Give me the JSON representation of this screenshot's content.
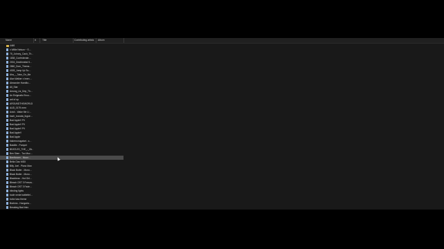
{
  "columns": {
    "name": "Name",
    "number": "#",
    "title": "Title",
    "artists": "Contributing artists",
    "album": "Album"
  },
  "files": [
    {
      "name": "4469",
      "type": "folder"
    },
    {
      "name": "x Willie Nelson ~ S…",
      "type": "file"
    },
    {
      "name": "75_Johnny_Cash_Th…",
      "type": "file"
    },
    {
      "name": "1838_Confederate…",
      "type": "file"
    },
    {
      "name": "2004_Deathmetal K…",
      "type": "file"
    },
    {
      "name": "2860_Dom_Thema…",
      "type": "file"
    },
    {
      "name": "4028_Jump Up Su…",
      "type": "file"
    },
    {
      "name": "Aha_-_Take_On_Me",
      "type": "file"
    },
    {
      "name": "Alan Walker x Imen…",
      "type": "file"
    },
    {
      "name": "Alexander Hamilto…",
      "type": "file"
    },
    {
      "name": "All_Star",
      "type": "file"
    },
    {
      "name": "Among_Us_Drip_Th…",
      "type": "file"
    },
    {
      "name": "An Enigmatic Enco…",
      "type": "file"
    },
    {
      "name": "anf of op",
      "type": "file"
    },
    {
      "name": "AROUNDTHEWORLD",
      "type": "file"
    },
    {
      "name": "AUD_0179.mrrn",
      "type": "file"
    },
    {
      "name": "Avicii - Wake Me U…",
      "type": "file"
    },
    {
      "name": "bach_toccata_fugue…",
      "type": "file"
    },
    {
      "name": "Bad Apple!! PV",
      "type": "file"
    },
    {
      "name": "Bad Apple!! PV",
      "type": "file"
    },
    {
      "name": "Bad Apple!! PV",
      "type": "file"
    },
    {
      "name": "Bad Apple!!",
      "type": "file"
    },
    {
      "name": "Bad Apple",
      "type": "file"
    },
    {
      "name": "bakemonogatari - s…",
      "type": "file"
    },
    {
      "name": "Bastille - Pompeii",
      "type": "file"
    },
    {
      "name": "BEATLES_THE_-_Ob…",
      "type": "file"
    },
    {
      "name": "Ben Siem - Too Muc…",
      "type": "file"
    },
    {
      "name": "Beethoven - Moon…",
      "type": "file",
      "selected": true
    },
    {
      "name": "Bella Ciao MIDI",
      "type": "file"
    },
    {
      "name": "Billy Joel - Piano Man",
      "type": "file"
    },
    {
      "name": "Black Butler - Mono…",
      "type": "file"
    },
    {
      "name": "Black Butler - Mono…",
      "type": "file"
    },
    {
      "name": "Blackbear - Hot Girl…",
      "type": "file"
    },
    {
      "name": "Bleach OST 3 Freeza…",
      "type": "file"
    },
    {
      "name": "Bleach OST 3 Fade…",
      "type": "file"
    },
    {
      "name": "blinding lights",
      "type": "file"
    },
    {
      "name": "bode verde battlefiel…",
      "type": "file"
    },
    {
      "name": "bofor lass theme",
      "type": "file"
    },
    {
      "name": "Brahms - Hungaria…",
      "type": "file"
    },
    {
      "name": "Breaking Bad Intro",
      "type": "file"
    }
  ]
}
